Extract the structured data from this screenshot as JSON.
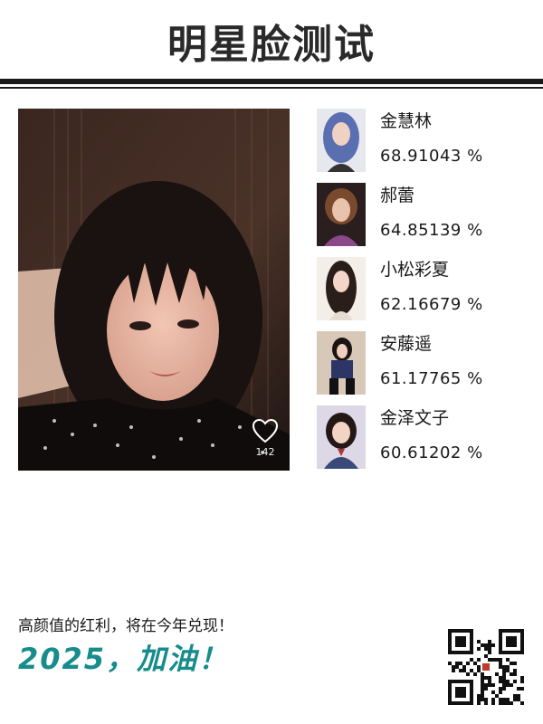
{
  "header": {
    "title": "明星脸测试"
  },
  "photo": {
    "like_count": "142",
    "like_icon": "heart-outline-icon"
  },
  "results": [
    {
      "name": "金慧林",
      "score": "68.91043 %",
      "accent": "#5a6fb0"
    },
    {
      "name": "郝蕾",
      "score": "64.85139 %",
      "accent": "#8a4a8a"
    },
    {
      "name": "小松彩夏",
      "score": "62.16679 %",
      "accent": "#c9a48a"
    },
    {
      "name": "安藤遥",
      "score": "61.17765 %",
      "accent": "#2c3565"
    },
    {
      "name": "金泽文子",
      "score": "60.61202 %",
      "accent": "#3a4a78"
    }
  ],
  "footer": {
    "tagline": "高颜值的红利，将在今年兑现！",
    "slogan": "2025，加油！",
    "slogan_color": "#168c8c",
    "qr_icon": "qr-code-icon"
  }
}
